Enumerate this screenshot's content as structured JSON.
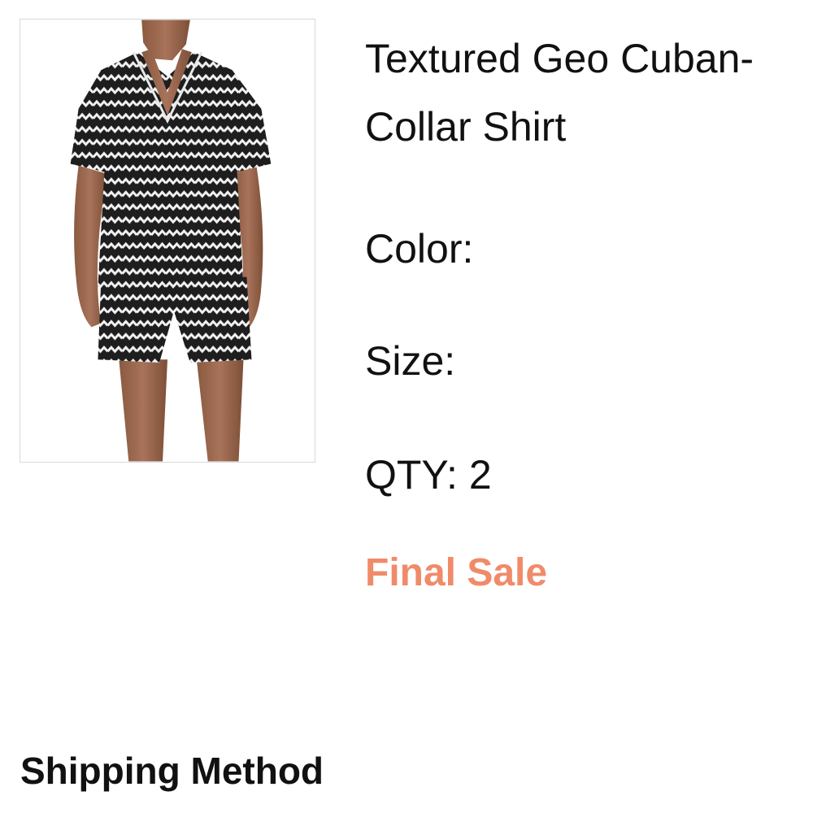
{
  "product": {
    "title": "Textured Geo Cuban-Collar Shirt",
    "color_label": "Color:",
    "color_value": "",
    "size_label": "Size:",
    "size_value": "",
    "qty_label": "QTY:",
    "qty_value": "2",
    "final_sale_label": "Final Sale",
    "final_sale_color": "#f08b6a",
    "image_icon": "product-photo-icon"
  },
  "shipping": {
    "heading": "Shipping Method"
  }
}
